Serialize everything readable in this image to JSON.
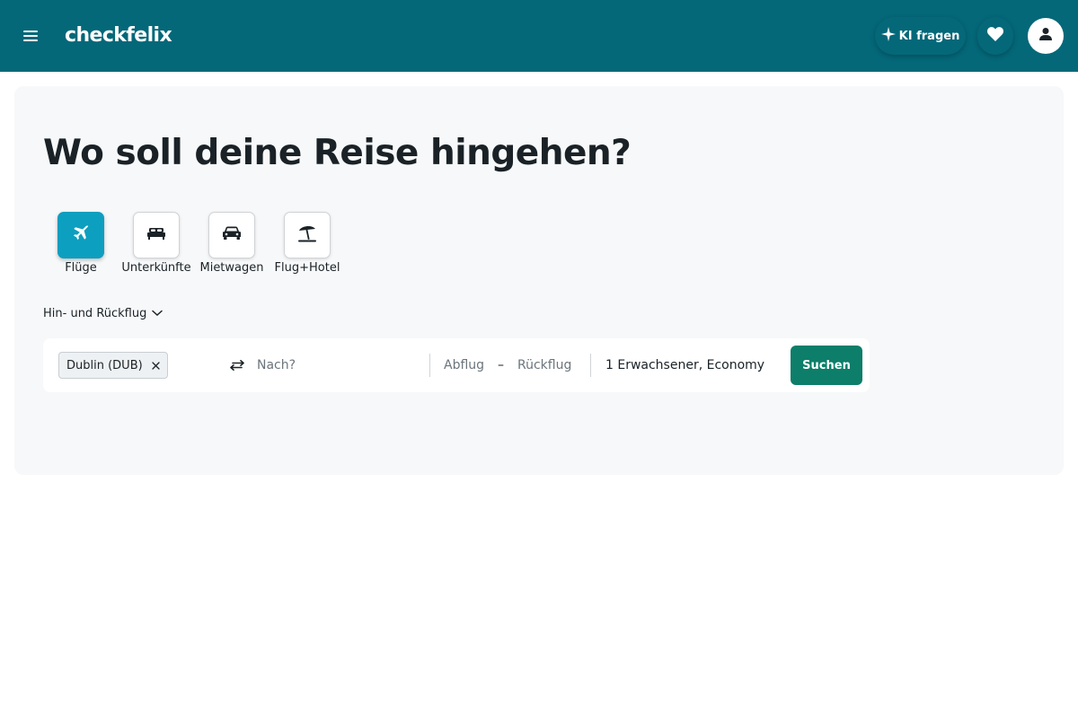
{
  "header": {
    "logo": "checkfelix",
    "ai_button_label": "KI fragen",
    "colors": {
      "bg": "#046879",
      "text": "#ffffff"
    },
    "icons": {
      "menu": "hamburger-menu-icon",
      "ai": "sparkle-icon",
      "favorites": "heart-icon",
      "account": "user-icon"
    }
  },
  "main": {
    "title": "Wo soll deine Reise hingehen?",
    "verticals": [
      {
        "label": "Flüge",
        "icon": "plane-icon",
        "active": true
      },
      {
        "label": "Unterkünfte",
        "icon": "bed-icon",
        "active": false
      },
      {
        "label": "Mietwagen",
        "icon": "car-icon",
        "active": false
      },
      {
        "label": "Flug+Hotel",
        "icon": "beach-umbrella-icon",
        "active": false
      }
    ],
    "trip_type": "Hin- und Rückflug",
    "search": {
      "origin_chip": "Dublin (DUB)",
      "destination_placeholder": "Nach?",
      "departure_label": "Abflug",
      "date_separator": "–",
      "return_label": "Rückflug",
      "travellers": "1 Erwachsener, Economy",
      "search_button": "Suchen"
    },
    "colors": {
      "active_vertical": "#0d9fc0",
      "search_button": "#0c7e69",
      "card_bg": "#f7f8f9"
    }
  }
}
